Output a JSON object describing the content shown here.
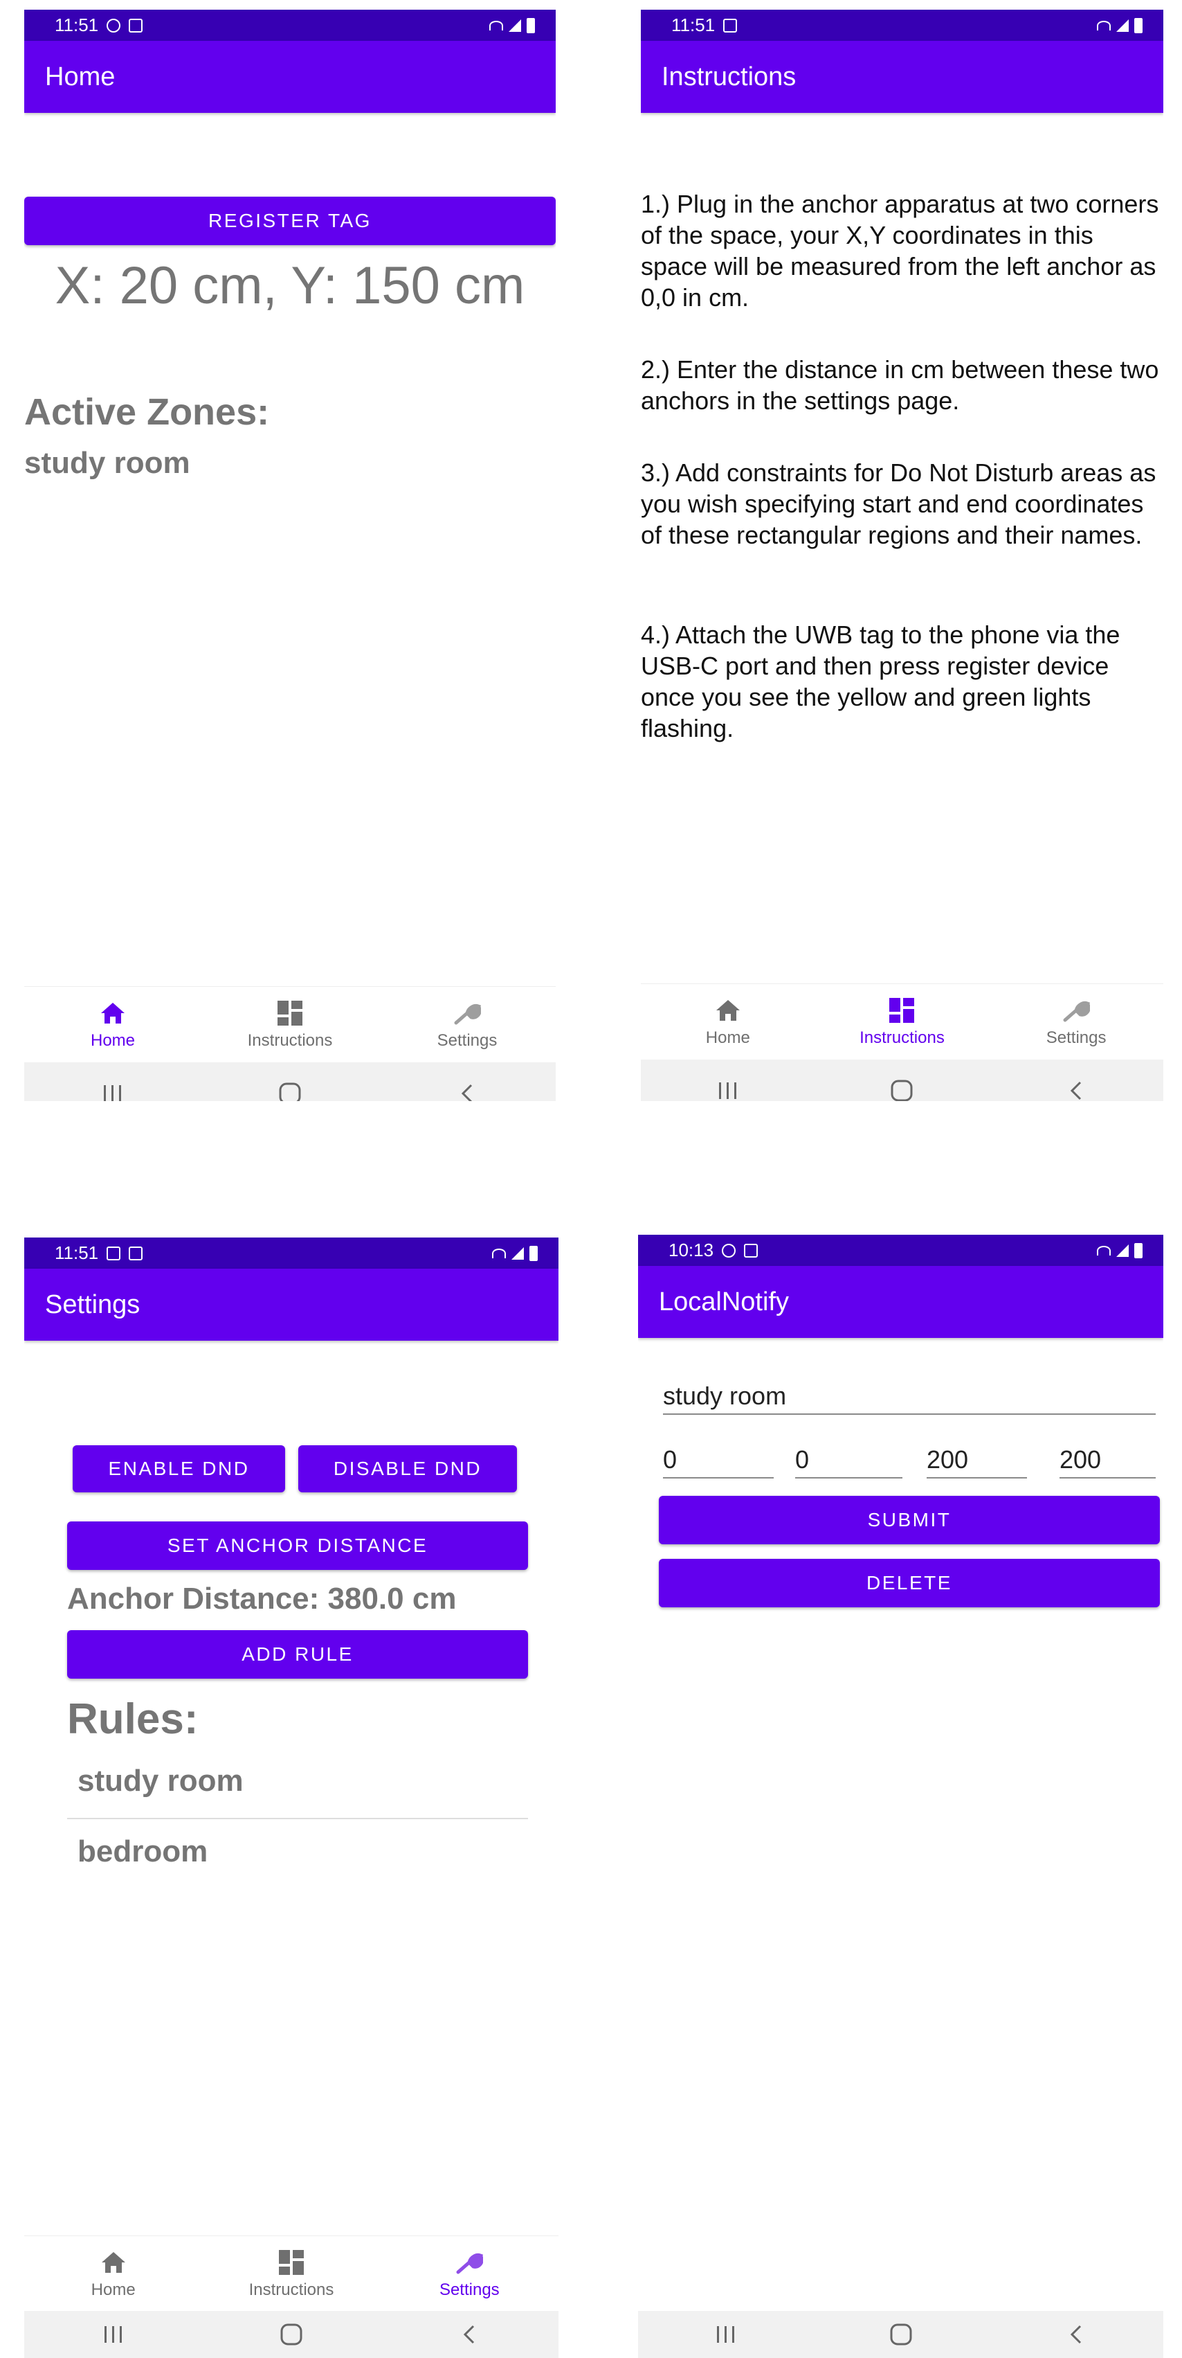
{
  "colors": {
    "primary": "#6200ee",
    "status_bar": "#3700b3",
    "text_grey": "#757575",
    "nav_inactive": "#6f6f6f"
  },
  "screens": {
    "home": {
      "status_time": "11:51",
      "app_title": "Home",
      "register_button": "REGISTER TAG",
      "coordinates": "X: 20 cm, Y: 150 cm",
      "active_zones_label": "Active Zones:",
      "active_zone": "study room"
    },
    "instructions": {
      "status_time": "11:51",
      "app_title": "Instructions",
      "steps": [
        "1.) Plug in the anchor apparatus at two corners of the space, your X,Y coordinates in this space will be measured from the left anchor as 0,0 in cm.",
        "2.) Enter the distance in cm between these two anchors in the settings page.",
        "3.) Add constraints for Do Not Disturb areas as you wish specifying start and end coordinates of these rectangular regions and their names.",
        "4.) Attach the UWB tag to the phone via the USB-C port and then press register device once you see the yellow and green lights flashing."
      ]
    },
    "settings": {
      "status_time": "11:51",
      "app_title": "Settings",
      "enable_dnd": "ENABLE DND",
      "disable_dnd": "DISABLE DND",
      "set_anchor_distance": "SET ANCHOR DISTANCE",
      "anchor_distance": "Anchor Distance: 380.0 cm",
      "add_rule": "ADD RULE",
      "rules_label": "Rules:",
      "rules": [
        "study room",
        "bedroom"
      ]
    },
    "localnotify": {
      "status_time": "10:13",
      "app_title": "LocalNotify",
      "name_value": "study room",
      "coord_values": [
        "0",
        "0",
        "200",
        "200"
      ],
      "submit": "SUBMIT",
      "delete": "DELETE"
    }
  },
  "bottom_nav": {
    "items": [
      {
        "label": "Home",
        "icon": "home-icon"
      },
      {
        "label": "Instructions",
        "icon": "dashboard-icon"
      },
      {
        "label": "Settings",
        "icon": "wrench-icon"
      }
    ]
  },
  "system_nav": {
    "icons": [
      "recents-icon",
      "home-circle-icon",
      "back-icon"
    ]
  }
}
